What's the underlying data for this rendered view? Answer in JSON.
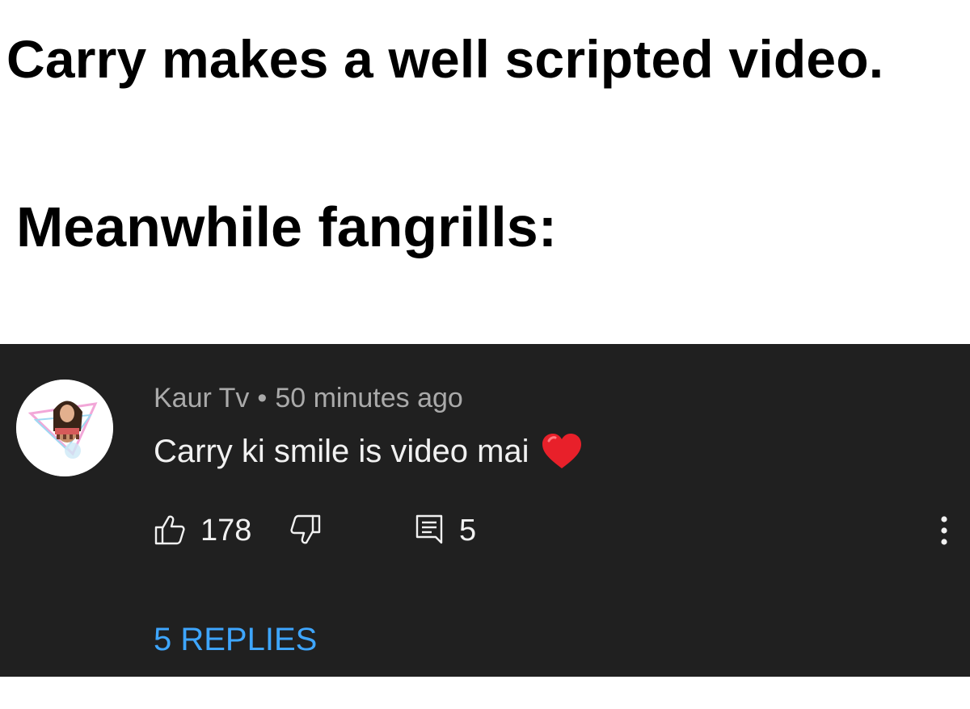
{
  "captions": {
    "line1": "Carry makes a well scripted video.",
    "line2": "Meanwhile fangrills:"
  },
  "comment": {
    "author": "Kaur Tv",
    "separator": "•",
    "timestamp": "50 minutes ago",
    "text": "Carry ki smile is video mai",
    "emoji_icon": "red-heart-icon",
    "like_count": "178",
    "reply_count": "5",
    "replies_label": "5 REPLIES",
    "avatar_icon": "profile-avatar",
    "colors": {
      "panel_background": "#202020",
      "meta_text": "#aaaaaa",
      "body_text": "#f1f1f1",
      "link": "#3ea6ff",
      "heart": "#e8202a"
    }
  }
}
